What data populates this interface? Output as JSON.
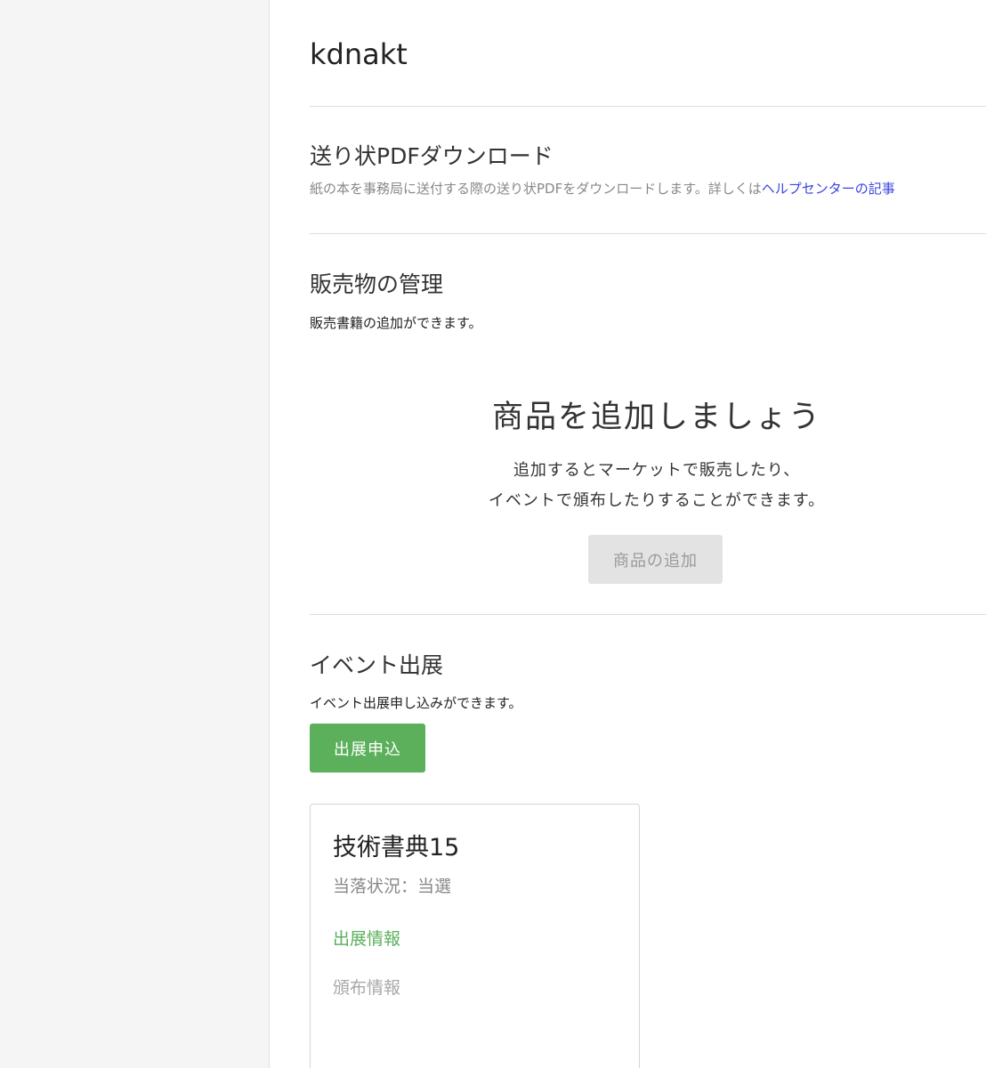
{
  "page": {
    "title": "kdnakt"
  },
  "invoice_section": {
    "heading": "送り状PDFダウンロード",
    "description": "紙の本を事務局に送付する際の送り状PDFをダウンロードします。詳しくは",
    "help_link": "ヘルプセンターの記事"
  },
  "products_section": {
    "heading": "販売物の管理",
    "description": "販売書籍の追加ができます。",
    "empty_heading": "商品を追加しましょう",
    "empty_line1": "追加するとマーケットで販売したり、",
    "empty_line2": "イベントで頒布したりすることができます。",
    "add_button": "商品の追加"
  },
  "events_section": {
    "heading": "イベント出展",
    "description": "イベント出展申し込みができます。",
    "apply_button": "出展申込",
    "card": {
      "title": "技術書典15",
      "status": "当落状況：当選",
      "exhibit_info": "出展情報",
      "distribution_info": "頒布情報"
    }
  },
  "colors": {
    "accent_green": "#5cb05c",
    "link_blue": "#3b45e0",
    "sidebar_bg": "#f5f5f5",
    "disabled_button_bg": "#e3e3e3"
  }
}
